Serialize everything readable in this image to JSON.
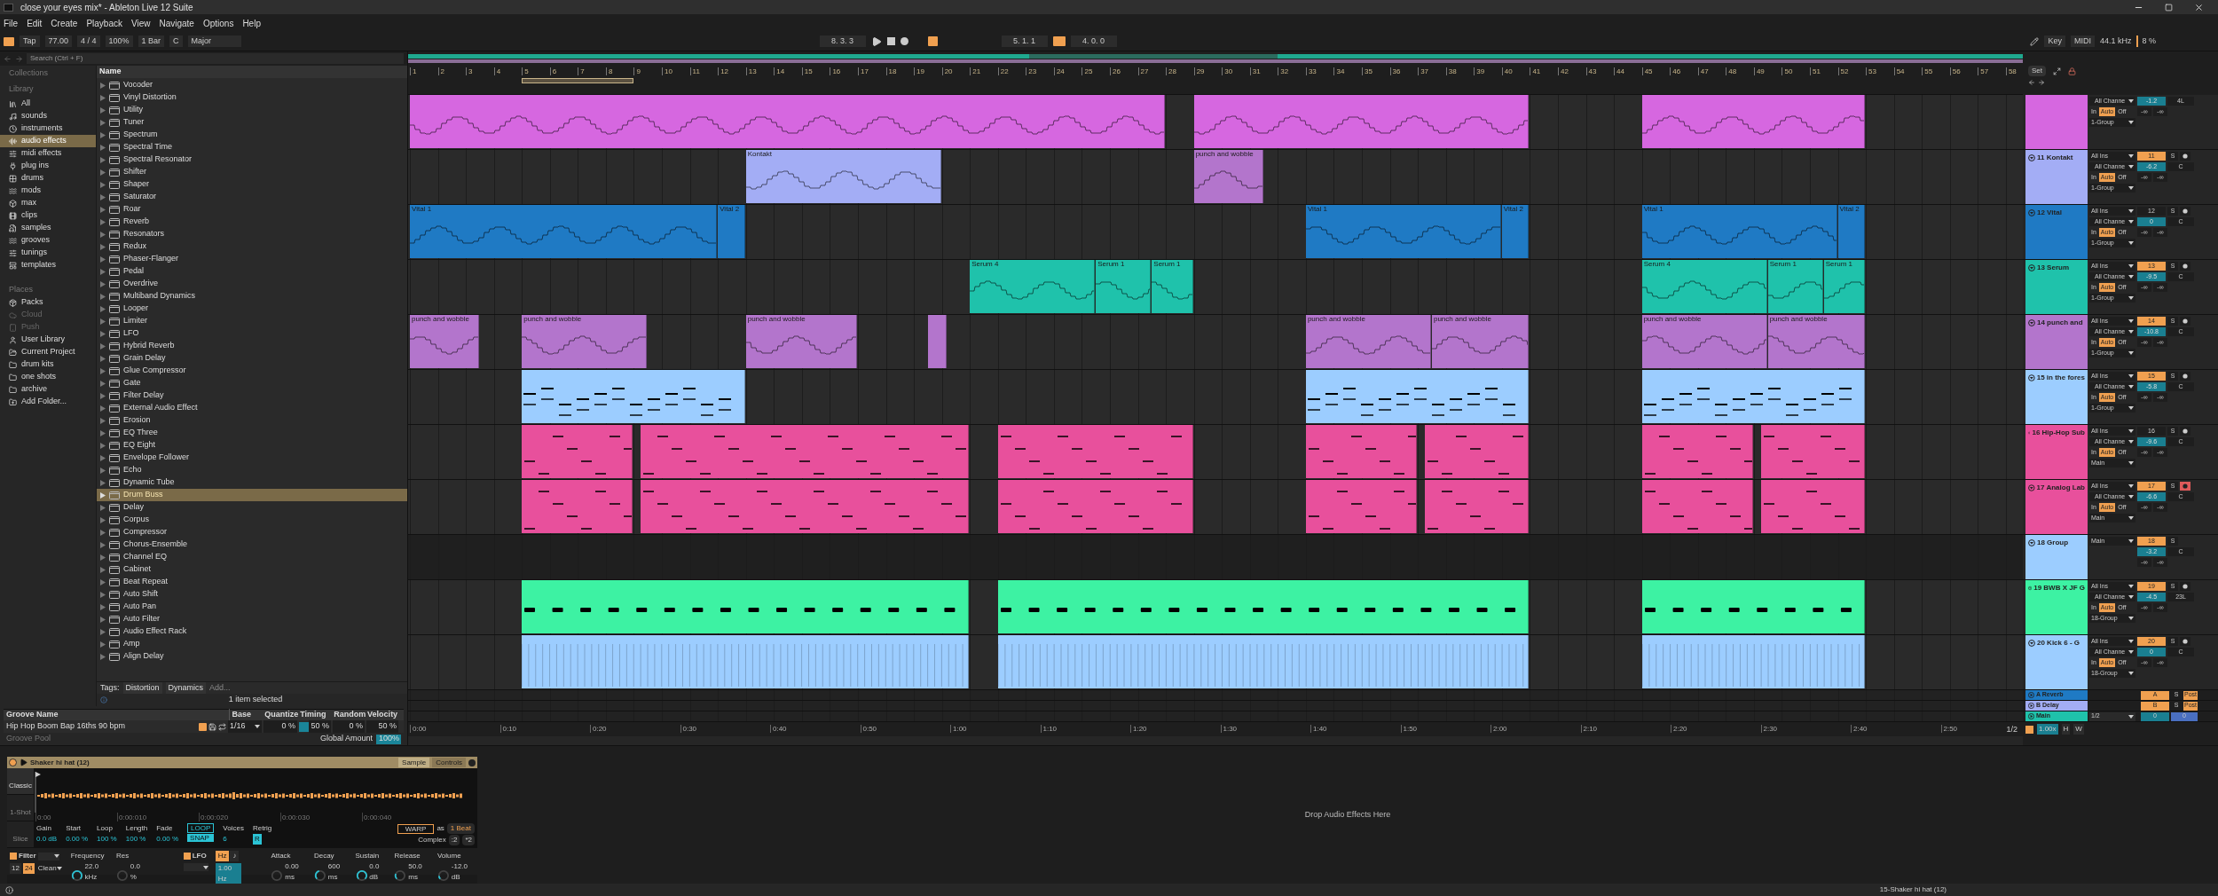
{
  "window": {
    "title": "close your eyes mix* - Ableton Live 12 Suite"
  },
  "menu": [
    "File",
    "Edit",
    "Create",
    "Playback",
    "View",
    "Navigate",
    "Options",
    "Help"
  ],
  "transport": {
    "tap": "Tap",
    "tempo": "77.00",
    "signature": "4 / 4",
    "zoom": "100%",
    "quantize": "1 Bar",
    "key": "C",
    "scale": "Major",
    "position": "8. 3. 3",
    "loop_on": true,
    "loop_start": "5. 1. 1",
    "loop_length": "4. 0. 0",
    "key_label": "Key",
    "midi_label": "MIDI",
    "sample_rate": "44.1 kHz",
    "cpu": "8 %"
  },
  "browser": {
    "search": {
      "placeholder": "Search (Ctrl + F)"
    },
    "collections_title": "Collections",
    "library_title": "Library",
    "library": [
      {
        "label": "All",
        "selected": false
      },
      {
        "label": "sounds",
        "selected": false
      },
      {
        "label": "instruments",
        "selected": false
      },
      {
        "label": "audio effects",
        "selected": true
      },
      {
        "label": "midi effects",
        "selected": false
      },
      {
        "label": "plug ins",
        "selected": false
      },
      {
        "label": "drums",
        "selected": false
      },
      {
        "label": "mods",
        "selected": false
      },
      {
        "label": "max",
        "selected": false
      },
      {
        "label": "clips",
        "selected": false
      },
      {
        "label": "samples",
        "selected": false
      },
      {
        "label": "grooves",
        "selected": false
      },
      {
        "label": "tunings",
        "selected": false
      },
      {
        "label": "templates",
        "selected": false
      }
    ],
    "places_title": "Places",
    "places": [
      {
        "label": "Packs",
        "disabled": false
      },
      {
        "label": "Cloud",
        "disabled": true
      },
      {
        "label": "Push",
        "disabled": true
      },
      {
        "label": "User Library",
        "disabled": false
      },
      {
        "label": "Current Project",
        "disabled": false
      },
      {
        "label": "drum kits",
        "disabled": false
      },
      {
        "label": "one shots",
        "disabled": false
      },
      {
        "label": "archive",
        "disabled": false
      },
      {
        "label": "Add Folder...",
        "disabled": false
      }
    ],
    "name_column": "Name",
    "items": [
      {
        "label": "Vocoder",
        "selected": false
      },
      {
        "label": "Vinyl Distortion",
        "selected": false
      },
      {
        "label": "Utility",
        "selected": false
      },
      {
        "label": "Tuner",
        "selected": false
      },
      {
        "label": "Spectrum",
        "selected": false
      },
      {
        "label": "Spectral Time",
        "selected": false
      },
      {
        "label": "Spectral Resonator",
        "selected": false
      },
      {
        "label": "Shifter",
        "selected": false
      },
      {
        "label": "Shaper",
        "selected": false
      },
      {
        "label": "Saturator",
        "selected": false
      },
      {
        "label": "Roar",
        "selected": false
      },
      {
        "label": "Reverb",
        "selected": false
      },
      {
        "label": "Resonators",
        "selected": false
      },
      {
        "label": "Redux",
        "selected": false
      },
      {
        "label": "Phaser-Flanger",
        "selected": false
      },
      {
        "label": "Pedal",
        "selected": false
      },
      {
        "label": "Overdrive",
        "selected": false
      },
      {
        "label": "Multiband Dynamics",
        "selected": false
      },
      {
        "label": "Looper",
        "selected": false
      },
      {
        "label": "Limiter",
        "selected": false
      },
      {
        "label": "LFO",
        "selected": false
      },
      {
        "label": "Hybrid Reverb",
        "selected": false
      },
      {
        "label": "Grain Delay",
        "selected": false
      },
      {
        "label": "Glue Compressor",
        "selected": false
      },
      {
        "label": "Gate",
        "selected": false
      },
      {
        "label": "Filter Delay",
        "selected": false
      },
      {
        "label": "External Audio Effect",
        "selected": false
      },
      {
        "label": "Erosion",
        "selected": false
      },
      {
        "label": "EQ Three",
        "selected": false
      },
      {
        "label": "EQ Eight",
        "selected": false
      },
      {
        "label": "Envelope Follower",
        "selected": false
      },
      {
        "label": "Echo",
        "selected": false
      },
      {
        "label": "Dynamic Tube",
        "selected": false
      },
      {
        "label": "Drum Buss",
        "selected": true
      },
      {
        "label": "Delay",
        "selected": false
      },
      {
        "label": "Corpus",
        "selected": false
      },
      {
        "label": "Compressor",
        "selected": false
      },
      {
        "label": "Chorus-Ensemble",
        "selected": false
      },
      {
        "label": "Channel EQ",
        "selected": false
      },
      {
        "label": "Cabinet",
        "selected": false
      },
      {
        "label": "Beat Repeat",
        "selected": false
      },
      {
        "label": "Auto Shift",
        "selected": false
      },
      {
        "label": "Auto Pan",
        "selected": false
      },
      {
        "label": "Auto Filter",
        "selected": false
      },
      {
        "label": "Audio Effect Rack",
        "selected": false
      },
      {
        "label": "Amp",
        "selected": false
      },
      {
        "label": "Align Delay",
        "selected": false
      }
    ],
    "tags_label": "Tags:",
    "tags": [
      "Distortion",
      "Dynamics"
    ],
    "tags_add": "Add...",
    "status": "1 item selected"
  },
  "groove": {
    "columns": [
      "Groove Name",
      "Base",
      "Quantize",
      "Timing",
      "Random",
      "Velocity"
    ],
    "row": {
      "name": "Hip Hop Boom Bap 16ths 90 bpm",
      "base": "1/16",
      "quantize": "0 %",
      "timing": "50 %",
      "random": "0 %",
      "velocity": "50 %"
    },
    "pool_label": "Groove Pool",
    "global_label": "Global Amount",
    "global_value": "100%"
  },
  "arrangement": {
    "bars": [
      "1",
      "2",
      "3",
      "4",
      "5",
      "6",
      "7",
      "8",
      "9",
      "10",
      "11",
      "12",
      "13",
      "14",
      "15",
      "16",
      "17",
      "18",
      "19",
      "20",
      "21",
      "22",
      "23",
      "24",
      "25",
      "26",
      "27",
      "28",
      "29",
      "30",
      "31",
      "32",
      "33",
      "34",
      "35",
      "36",
      "37",
      "38",
      "39",
      "40",
      "41",
      "42",
      "43",
      "44",
      "45",
      "46",
      "47",
      "48",
      "49",
      "50",
      "51",
      "52",
      "53",
      "54",
      "55",
      "56",
      "57",
      "58"
    ],
    "times": [
      "0:00",
      "0:10",
      "0:20",
      "0:30",
      "0:40",
      "0:50",
      "1:00",
      "1:10",
      "1:20",
      "1:30",
      "1:40",
      "1:50",
      "2:00",
      "2:10",
      "2:20",
      "2:30",
      "2:40",
      "2:50"
    ],
    "page": "1/2"
  },
  "tracks": [
    {
      "kind": "track",
      "color": "#d667e0",
      "mixer": {
        "channel": "All Channe",
        "monitor": [
          {
            "label": "In",
            "selected": false
          },
          {
            "label": "Auto",
            "selected": true
          },
          {
            "label": "Off",
            "selected": false
          }
        ],
        "output": "1-Group",
        "volume": "-1.2",
        "pan": "4L",
        "sends": [
          "-∞",
          "-∞"
        ]
      }
    },
    {
      "kind": "track",
      "name": "11 Kontakt",
      "color": "#a3adf5",
      "clips": [
        {
          "name": "Kontakt"
        },
        {
          "name": "punch and wobble",
          "color": "#b375cc"
        }
      ],
      "mixer": {
        "input": "All Ins",
        "number": "11",
        "number_on": true,
        "solo": "S",
        "arm": false,
        "channel": "All Channe",
        "monitor": [
          {
            "label": "In",
            "selected": false
          },
          {
            "label": "Auto",
            "selected": true
          },
          {
            "label": "Off",
            "selected": false
          }
        ],
        "output": "1-Group",
        "volume": "-6.2",
        "pan": "C",
        "sends": [
          "-∞",
          "-∞"
        ]
      }
    },
    {
      "kind": "track",
      "name": "12 Vital",
      "color": "#1f7ac4",
      "clips": [
        {
          "name": "Vital 1"
        },
        {
          "name": "Vital 2"
        },
        {
          "name": "Vital 1"
        },
        {
          "name": "Vital 2"
        },
        {
          "name": "Vital 1"
        },
        {
          "name": "Vital 2"
        }
      ],
      "mixer": {
        "input": "All Ins",
        "number": "12",
        "number_on": false,
        "solo": "S",
        "arm": false,
        "channel": "All Channe",
        "monitor": [
          {
            "label": "In",
            "selected": false
          },
          {
            "label": "Auto",
            "selected": true
          },
          {
            "label": "Off",
            "selected": false
          }
        ],
        "output": "1-Group",
        "volume": "0",
        "pan": "C",
        "sends": [
          "-∞",
          "-∞"
        ]
      }
    },
    {
      "kind": "track",
      "name": "13 Serum",
      "color": "#1fc2ab",
      "clips": [
        {
          "name": "Serum 4"
        },
        {
          "name": "Serum 1"
        },
        {
          "name": "Serum 1"
        },
        {
          "name": "Serum 4"
        },
        {
          "name": "Serum 1"
        },
        {
          "name": "Serum 1"
        }
      ],
      "mixer": {
        "input": "All Ins",
        "number": "13",
        "number_on": true,
        "solo": "S",
        "arm": false,
        "channel": "All Channe",
        "monitor": [
          {
            "label": "In",
            "selected": false
          },
          {
            "label": "Auto",
            "selected": true
          },
          {
            "label": "Off",
            "selected": false
          }
        ],
        "output": "1-Group",
        "volume": "-9.5",
        "pan": "C",
        "sends": [
          "-∞",
          "-∞"
        ]
      }
    },
    {
      "kind": "track",
      "name": "14 punch and",
      "color": "#b375cc",
      "clips": [
        {
          "name": "punch and wobble"
        },
        {
          "name": "punch and wobble"
        },
        {
          "name": "punch and wobble"
        },
        {
          "name": "punch and wobble"
        },
        {
          "name": "punch and wobble"
        },
        {
          "name": "punch and wobble"
        },
        {
          "name": "punch and wobble"
        }
      ],
      "mixer": {
        "input": "All Ins",
        "number": "14",
        "number_on": true,
        "solo": "S",
        "arm": false,
        "channel": "All Channe",
        "monitor": [
          {
            "label": "In",
            "selected": false
          },
          {
            "label": "Auto",
            "selected": true
          },
          {
            "label": "Off",
            "selected": false
          }
        ],
        "output": "1-Group",
        "volume": "-10.8",
        "pan": "C",
        "sends": [
          "-∞",
          "-∞"
        ]
      }
    },
    {
      "kind": "track",
      "name": "15 in the fores",
      "color": "#9ccdff",
      "mixer": {
        "input": "All Ins",
        "number": "15",
        "number_on": true,
        "solo": "S",
        "arm": false,
        "channel": "All Channe",
        "monitor": [
          {
            "label": "In",
            "selected": false
          },
          {
            "label": "Auto",
            "selected": true
          },
          {
            "label": "Off",
            "selected": false
          }
        ],
        "output": "1-Group",
        "volume": "-5.8",
        "pan": "C",
        "sends": [
          "-∞",
          "-∞"
        ]
      }
    },
    {
      "kind": "track",
      "name": "16 Hip-Hop Sub",
      "color": "#e8509c",
      "mixer": {
        "input": "All Ins",
        "number": "16",
        "number_on": false,
        "solo": "S",
        "arm": false,
        "channel": "All Channe",
        "monitor": [
          {
            "label": "In",
            "selected": false
          },
          {
            "label": "Auto",
            "selected": true
          },
          {
            "label": "Off",
            "selected": false
          }
        ],
        "output": "Main",
        "volume": "-9.6",
        "pan": "C",
        "sends": [
          "-∞",
          "-∞"
        ]
      }
    },
    {
      "kind": "track",
      "name": "17 Analog Lab",
      "color": "#e8509c",
      "mixer": {
        "input": "All Ins",
        "number": "17",
        "number_on": true,
        "solo": "S",
        "arm": true,
        "channel": "All Channe",
        "monitor": [
          {
            "label": "In",
            "selected": false
          },
          {
            "label": "Auto",
            "selected": true
          },
          {
            "label": "Off",
            "selected": false
          }
        ],
        "output": "Main",
        "volume": "-6.6",
        "pan": "C",
        "sends": [
          "-∞",
          "-∞"
        ]
      }
    },
    {
      "kind": "group",
      "name": "18 Group",
      "color": "#9ccdff",
      "mixer": {
        "output": "Main",
        "number": "18",
        "number_on": true,
        "solo": "S",
        "volume": "-3.2",
        "pan": "C",
        "sends": [
          "-∞",
          "-∞"
        ]
      }
    },
    {
      "kind": "track",
      "name": "19 BWB X JF G",
      "color": "#3df2a3",
      "mixer": {
        "input": "All Ins",
        "number": "19",
        "number_on": true,
        "solo": "S",
        "arm": false,
        "channel": "All Channe",
        "monitor": [
          {
            "label": "In",
            "selected": false
          },
          {
            "label": "Auto",
            "selected": true
          },
          {
            "label": "Off",
            "selected": false
          }
        ],
        "output": "18-Group",
        "volume": "-4.5",
        "pan": "23L",
        "sends": [
          "-∞",
          "-∞"
        ]
      }
    },
    {
      "kind": "track",
      "name": "20 Kick 6 - G",
      "color": "#9ccdff",
      "mixer": {
        "input": "All Ins",
        "number": "20",
        "number_on": true,
        "solo": "S",
        "arm": false,
        "channel": "All Channe",
        "monitor": [
          {
            "label": "In",
            "selected": false
          },
          {
            "label": "Auto",
            "selected": true
          },
          {
            "label": "Off",
            "selected": false
          }
        ],
        "output": "18-Group",
        "volume": "0",
        "pan": "C",
        "sends": [
          "-∞",
          "-∞"
        ]
      }
    }
  ],
  "returns": [
    {
      "kind": "return",
      "name": "A Reverb",
      "color": "#1f7ac4",
      "number": "A",
      "solo": "S",
      "mode": "Post"
    },
    {
      "kind": "return",
      "name": "B Delay",
      "color": "#a3adf5",
      "number": "B",
      "solo": "S",
      "mode": "Post"
    },
    {
      "kind": "main",
      "name": "Main",
      "color": "#1fc2ab",
      "output": "1/2",
      "volume": "0",
      "pan": "0"
    }
  ],
  "mixer_top": {
    "set": "Set"
  },
  "mixer_bottom": {
    "zoom": "1.00x",
    "h": "H",
    "w": "W"
  },
  "device": {
    "title": "Shaker hi hat (12)",
    "tabs": [
      {
        "label": "Sample",
        "selected": true
      },
      {
        "label": "Controls",
        "selected": false
      }
    ],
    "modes": [
      {
        "label": "Classic",
        "selected": true
      },
      {
        "label": "1-Shot",
        "selected": false
      },
      {
        "label": "Slice",
        "selected": false
      }
    ],
    "times": [
      "0:00",
      "0:00:010",
      "0:00:020",
      "0:00:030",
      "0:00:040"
    ],
    "params": [
      {
        "label": "Gain",
        "value": "0.0 dB"
      },
      {
        "label": "Start",
        "value": "0.00 %"
      },
      {
        "label": "Loop",
        "value": "100 %"
      },
      {
        "label": "Length",
        "value": "100 %"
      },
      {
        "label": "Fade",
        "value": "0.00 %"
      }
    ],
    "loop": "LOOP",
    "snap": "SNAP",
    "voices": {
      "label": "Voices",
      "value": "6"
    },
    "retrig": {
      "label": "Retrig",
      "value": "R"
    },
    "warp": "WARP",
    "as": "as",
    "beat": "1 Beat",
    "warp_mode": "Complex",
    "halve": ":2",
    "double": "*2",
    "filter": {
      "label": "Filter",
      "on": true,
      "slopes": [
        {
          "label": "12",
          "selected": false
        },
        {
          "label": "24",
          "selected": true
        }
      ],
      "mode": "Clean"
    },
    "knobs1": [
      {
        "label": "Frequency",
        "value": "22.0 kHz"
      },
      {
        "label": "Res",
        "value": "0.0 %"
      }
    ],
    "lfo": {
      "label": "LFO",
      "on": true,
      "units": [
        {
          "label": "Hz",
          "selected": true
        },
        {
          "label": "♪",
          "selected": false
        }
      ],
      "rate": "1.00 Hz"
    },
    "knobs2": [
      {
        "label": "Attack",
        "value": "0.00 ms"
      },
      {
        "label": "Decay",
        "value": "600 ms"
      },
      {
        "label": "Sustain",
        "value": "0.0 dB"
      },
      {
        "label": "Release",
        "value": "50.0 ms"
      },
      {
        "label": "Volume",
        "value": "-12.0 dB"
      }
    ]
  },
  "drop_hint": "Drop Audio Effects Here",
  "status_bar": {
    "selected": "15-Shaker hi hat (12)"
  }
}
